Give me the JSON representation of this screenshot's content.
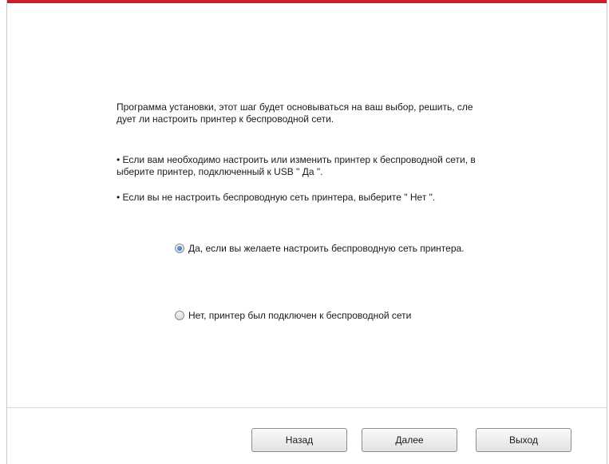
{
  "accent_color": "#c8202a",
  "intro": "Программа установки, этот шаг будет основываться на ваш выбор, решить, сле дует ли настроить принтер к беспроводной сети.",
  "bullets": [
    "• Если вам необходимо настроить или изменить принтер к беспроводной сети, в ыберите принтер, подключенный к USB \" Да \".",
    "• Если вы не настроить беспроводную сеть принтера, выберите \" Нет \"."
  ],
  "options": [
    {
      "label": "Да, если вы желаете настроить беспроводную сеть принтера.",
      "selected": true
    },
    {
      "label": "Нет, принтер был подключен к беспроводной сети",
      "selected": false
    }
  ],
  "buttons": {
    "back": "Назад",
    "next": "Далее",
    "exit": "Выход"
  }
}
